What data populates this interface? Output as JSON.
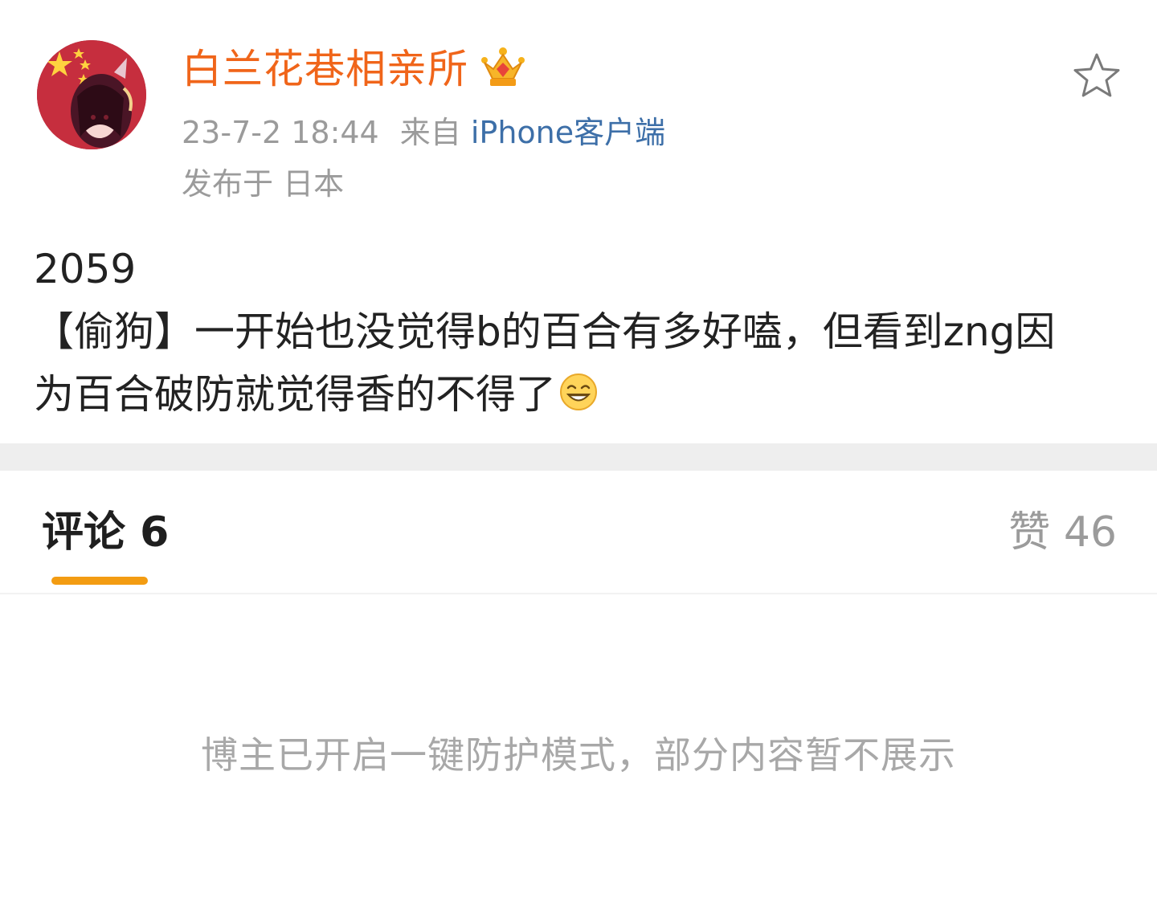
{
  "header": {
    "username": "白兰花巷相亲所",
    "timestamp": "23-7-2 18:44",
    "source_prefix": "来自",
    "source": "iPhone客户端",
    "location": "发布于 日本"
  },
  "post": {
    "lines": [
      "2059",
      "【偷狗】一开始也没觉得b的百合有多好嗑，但看到zng因",
      "为百合破防就觉得香的不得了"
    ]
  },
  "tabs": {
    "comments": "评论 6",
    "likes": "赞 46"
  },
  "notice": "博主已开启一键防护模式，部分内容暂不展示",
  "colors": {
    "username": "#f0651a",
    "source_link": "#3d6fa8",
    "tab_indicator": "#f39c12",
    "muted_text": "#9b9b9b"
  },
  "icons": {
    "crown": "crown-badge-icon",
    "favorite": "star-outline-icon",
    "emoji": "grin-emoji-icon"
  }
}
